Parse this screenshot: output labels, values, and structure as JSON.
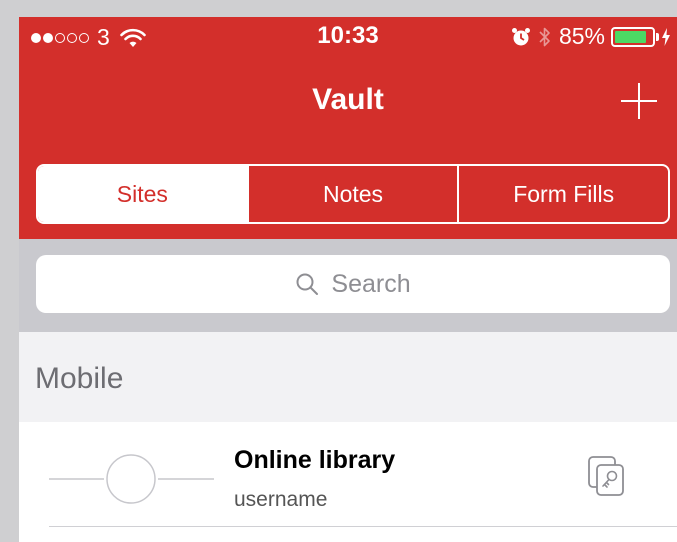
{
  "status_bar": {
    "carrier": "3",
    "time": "10:33",
    "battery_percent": "85%",
    "battery_level": 0.85,
    "signal_bars_filled": 2,
    "signal_bars_total": 5
  },
  "nav": {
    "title": "Vault",
    "add_icon": "plus-icon"
  },
  "tabs": [
    {
      "label": "Sites",
      "active": true
    },
    {
      "label": "Notes",
      "active": false
    },
    {
      "label": "Form Fills",
      "active": false
    }
  ],
  "search": {
    "placeholder": "Search"
  },
  "sections": [
    {
      "title": "Mobile",
      "items": [
        {
          "title": "Online library",
          "subtitle": "username",
          "icon": "site-placeholder-icon",
          "action_icon": "copy-password-icon"
        }
      ]
    }
  ],
  "colors": {
    "brand_red": "#d32f2b",
    "battery_green": "#4cd964",
    "search_bg": "#c9c9ce",
    "section_text": "#6d6d72"
  }
}
